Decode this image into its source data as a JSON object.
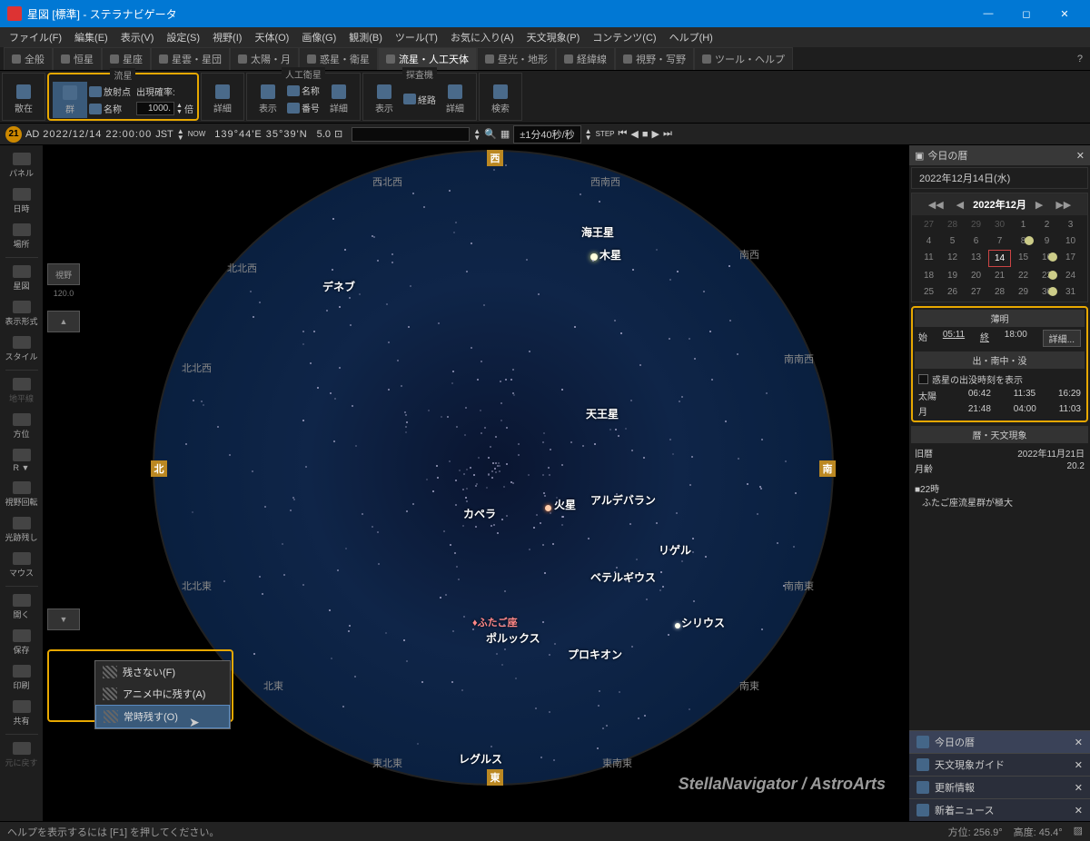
{
  "window": {
    "title": "星図 [標準] - ステラナビゲータ"
  },
  "menu": [
    "ファイル(F)",
    "編集(E)",
    "表示(V)",
    "設定(S)",
    "視野(I)",
    "天体(O)",
    "画像(G)",
    "観測(B)",
    "ツール(T)",
    "お気に入り(A)",
    "天文現象(P)",
    "コンテンツ(C)",
    "ヘルプ(H)"
  ],
  "tabs": [
    {
      "label": "全般"
    },
    {
      "label": "恒星"
    },
    {
      "label": "星座"
    },
    {
      "label": "星雲・星団"
    },
    {
      "label": "太陽・月"
    },
    {
      "label": "惑星・衛星"
    },
    {
      "label": "流星・人工天体",
      "active": true
    },
    {
      "label": "昼光・地形"
    },
    {
      "label": "経緯線"
    },
    {
      "label": "視野・写野"
    },
    {
      "label": "ツール・ヘルプ"
    }
  ],
  "tab_help_icon": "?",
  "ribbon": {
    "scatter": "散在",
    "meteor_group": {
      "label": "流星",
      "group": "群",
      "radiant": "放射点",
      "name": "名称",
      "prob_label": "出現確率:",
      "prob_value": "1000.",
      "times": "倍",
      "detail": "詳細"
    },
    "satellite": {
      "label": "人工衛星",
      "show": "表示",
      "name": "名称",
      "number": "番号",
      "detail": "詳細"
    },
    "probe": {
      "label": "探査機",
      "show": "表示",
      "route": "経路",
      "detail": "詳細"
    },
    "search": "検索"
  },
  "infobar": {
    "badge": "21",
    "era": "AD",
    "datetime": "2022/12/14 22:00:00",
    "tz": "JST",
    "now": "NOW",
    "coords": "139°44'E 35°39'N",
    "fov": "5.0",
    "speed": "±1分40秒/秒",
    "step": "STEP"
  },
  "side_left": [
    {
      "label": "パネル"
    },
    {
      "label": "日時"
    },
    {
      "label": "場所"
    },
    {
      "sep": true
    },
    {
      "label": "星図"
    },
    {
      "label": "表示形式"
    },
    {
      "label": "スタイル"
    },
    {
      "sep": true
    },
    {
      "label": "地平線",
      "disabled": true
    },
    {
      "label": "方位"
    },
    {
      "label": "R ▼"
    },
    {
      "label": "視野回転"
    },
    {
      "label": "光跡残し"
    },
    {
      "label": "マウス"
    },
    {
      "sep": true
    },
    {
      "label": "開く"
    },
    {
      "label": "保存"
    },
    {
      "label": "印刷"
    },
    {
      "label": "共有"
    },
    {
      "sep": true
    },
    {
      "label": "元に戻す",
      "disabled": true
    }
  ],
  "sky_extras": {
    "fov": "視野",
    "fov_val": "120.0",
    "up": "▲",
    "down": "▼"
  },
  "context_menu": {
    "items": [
      "残さない(F)",
      "アニメ中に残す(A)",
      "常時残す(O)"
    ]
  },
  "sky_labels": {
    "neptune": "海王星",
    "jupiter": "木星",
    "deneb": "デネブ",
    "uranus": "天王星",
    "mars": "火星",
    "capella": "カペラ",
    "aldebaran": "アルデバラン",
    "rigel": "リゲル",
    "betelgeuse": "ベテルギウス",
    "sirius": "シリウス",
    "procyon": "プロキオン",
    "pollux": "ポルックス",
    "regulus": "レグルス",
    "gemini": "♦ふたご座"
  },
  "directions": {
    "N": "北",
    "S": "南",
    "E": "東",
    "W": "西",
    "NNW": "北北西",
    "NW": "西北西",
    "WNW": "西南西",
    "NE": "南西",
    "SSW": "南南西",
    "SSE": "南南東",
    "SE": "南東",
    "ENE": "北東",
    "NNE": "東北東",
    "ESE": "東南東"
  },
  "watermark": "StellaNavigator / AstroArts",
  "right_panel": {
    "header": "今日の暦",
    "date": "2022年12月14日(水)",
    "cal_title": "2022年12月",
    "cal_prev": "◀◀",
    "cal_prev1": "◀",
    "cal_next1": "▶",
    "cal_next": "▶▶",
    "weekdays": [],
    "days": [
      {
        "n": "27",
        "dim": true
      },
      {
        "n": "28",
        "dim": true
      },
      {
        "n": "29",
        "dim": true
      },
      {
        "n": "30",
        "dim": true
      },
      {
        "n": "1"
      },
      {
        "n": "2"
      },
      {
        "n": "3"
      },
      {
        "n": "4"
      },
      {
        "n": "5"
      },
      {
        "n": "6"
      },
      {
        "n": "7"
      },
      {
        "n": "8",
        "moon": true
      },
      {
        "n": "9"
      },
      {
        "n": "10"
      },
      {
        "n": "11"
      },
      {
        "n": "12"
      },
      {
        "n": "13"
      },
      {
        "n": "14",
        "today": true
      },
      {
        "n": "15"
      },
      {
        "n": "16",
        "moon": true
      },
      {
        "n": "17"
      },
      {
        "n": "18"
      },
      {
        "n": "19"
      },
      {
        "n": "20"
      },
      {
        "n": "21"
      },
      {
        "n": "22"
      },
      {
        "n": "23",
        "moon": true
      },
      {
        "n": "24"
      },
      {
        "n": "25"
      },
      {
        "n": "26"
      },
      {
        "n": "27"
      },
      {
        "n": "28"
      },
      {
        "n": "29"
      },
      {
        "n": "30",
        "moon": true
      },
      {
        "n": "31"
      }
    ],
    "twilight": {
      "header": "薄明",
      "start_l": "始",
      "start": "05:11",
      "end_l": "終",
      "end": "18:00",
      "detail": "詳細..."
    },
    "rise_set": {
      "header": "出・南中・没",
      "chk": "惑星の出没時刻を表示",
      "sun_l": "太陽",
      "sun": [
        "06:42",
        "11:35",
        "16:29"
      ],
      "moon_l": "月",
      "moon": [
        "21:48",
        "04:00",
        "11:03"
      ]
    },
    "almanac": {
      "header": "暦・天文現象",
      "old_cal_l": "旧暦",
      "old_cal": "2022年11月21日",
      "moon_age_l": "月齢",
      "moon_age": "20.2",
      "event_time": "■22時",
      "event": "ふたご座流星群が極大"
    },
    "bottom_tabs": [
      "今日の暦",
      "天文現象ガイド",
      "更新情報",
      "新着ニュース"
    ]
  },
  "status": {
    "hint": "ヘルプを表示するには [F1] を押してください。",
    "az_l": "方位:",
    "az": "256.9°",
    "alt_l": "高度:",
    "alt": "45.4°"
  }
}
